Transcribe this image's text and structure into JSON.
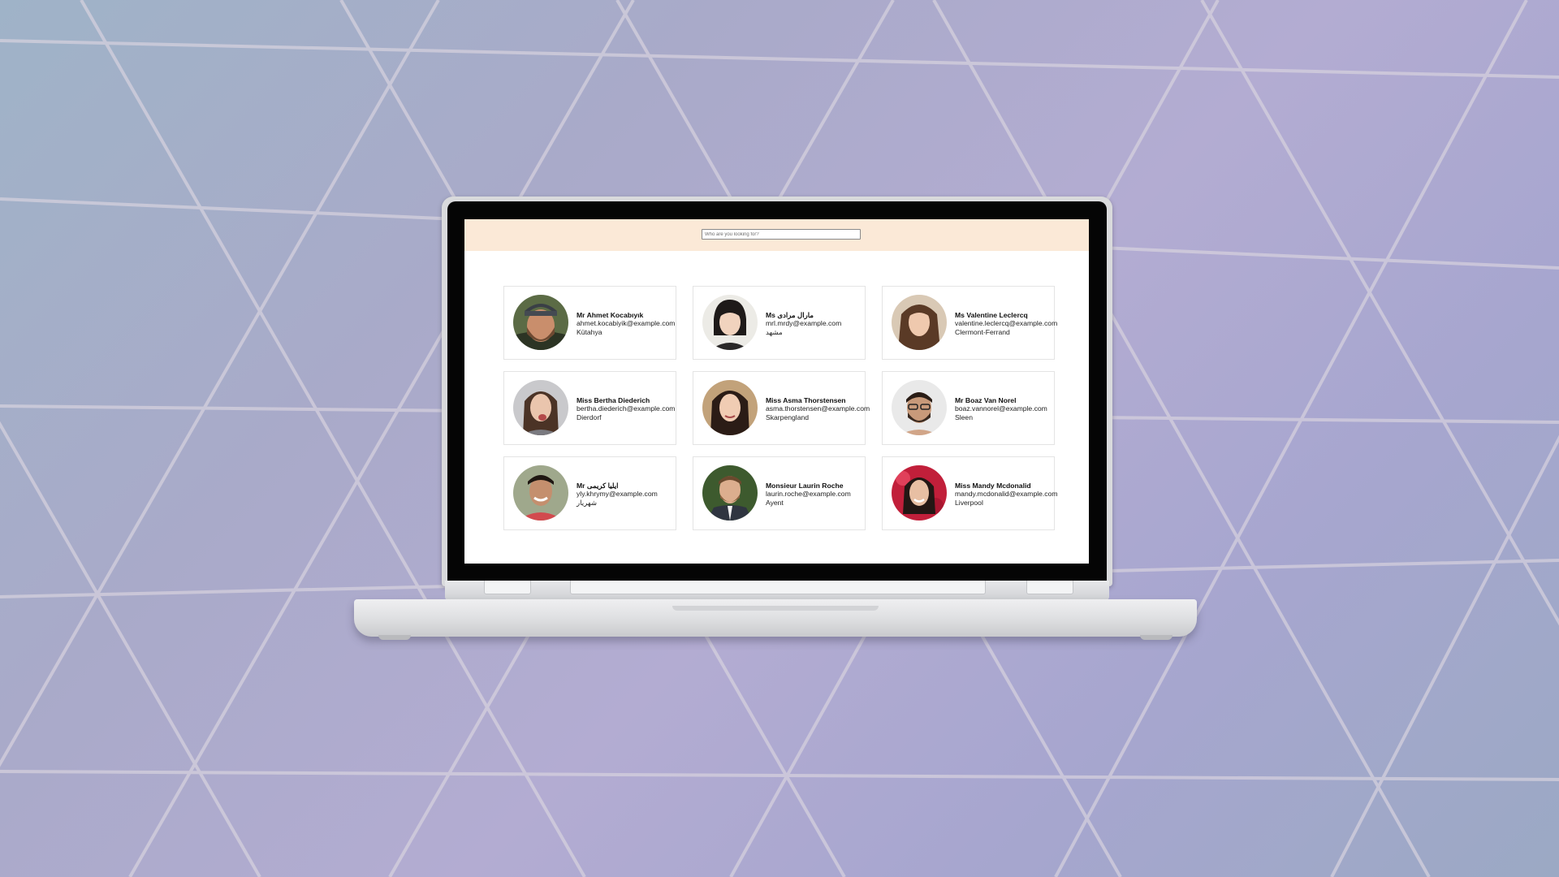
{
  "search": {
    "placeholder": "Who are you looking for?"
  },
  "colors": {
    "header_bg": "#fbe9d7",
    "card_border": "#e4e4e4",
    "screen_bg": "#ffffff"
  },
  "people": [
    {
      "title": "Mr",
      "name": "Ahmet Kocabıyık",
      "email": "ahmet.kocabiyik@example.com",
      "city": "Kütahya"
    },
    {
      "title": "Ms",
      "name": "مارال مرادی",
      "email": "mrl.mrdy@example.com",
      "city": "مشهد"
    },
    {
      "title": "Ms",
      "name": "Valentine Leclercq",
      "email": "valentine.leclercq@example.com",
      "city": "Clermont-Ferrand"
    },
    {
      "title": "Miss",
      "name": "Bertha Diederich",
      "email": "bertha.diederich@example.com",
      "city": "Dierdorf"
    },
    {
      "title": "Miss",
      "name": "Asma Thorstensen",
      "email": "asma.thorstensen@example.com",
      "city": "Skarpengland"
    },
    {
      "title": "Mr",
      "name": "Boaz Van Norel",
      "email": "boaz.vannorel@example.com",
      "city": "Sleen"
    },
    {
      "title": "Mr",
      "name": "ایلیا کریمی",
      "email": "yly.khrymy@example.com",
      "city": "شهریار"
    },
    {
      "title": "Monsieur",
      "name": "Laurin Roche",
      "email": "laurin.roche@example.com",
      "city": "Ayent"
    },
    {
      "title": "Miss",
      "name": "Mandy Mcdonalid",
      "email": "mandy.mcdonalid@example.com",
      "city": "Liverpool"
    }
  ]
}
